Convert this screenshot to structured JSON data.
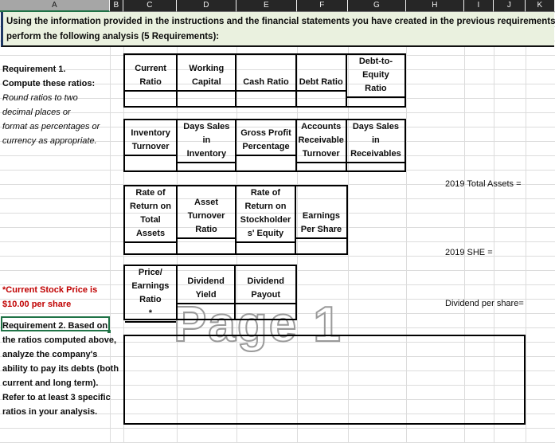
{
  "app": {
    "type": "spreadsheet"
  },
  "columns": [
    {
      "label": "A",
      "selected": true
    },
    {
      "label": "B",
      "selected": false
    },
    {
      "label": "C",
      "selected": false
    },
    {
      "label": "D",
      "selected": false
    },
    {
      "label": "E",
      "selected": false
    },
    {
      "label": "F",
      "selected": false
    },
    {
      "label": "G",
      "selected": false
    },
    {
      "label": "H",
      "selected": false
    },
    {
      "label": "I",
      "selected": false
    },
    {
      "label": "J",
      "selected": false
    },
    {
      "label": "K",
      "selected": false
    }
  ],
  "banner": {
    "line1": "Using the information provided in the instructions and the financial statements you have created in the previous requirements,",
    "line2": "perform the following analysis (5 Requirements):",
    "background_color": "#eaf1df"
  },
  "requirement1": {
    "title_line1": "Requirement 1.",
    "title_line2": "Compute these ratios:",
    "note_line1": "Round ratios to two",
    "note_line2": "decimal places or",
    "note_line3": "format as percentages or",
    "note_line4": "currency as appropriate."
  },
  "stock_note": {
    "line1": "*Current Stock Price is",
    "line2": "$10.00 per share",
    "color": "#c00000"
  },
  "requirement2": {
    "line1": "Requirement 2. Based on",
    "line2": "the ratios computed above,",
    "line3": "analyze the company's",
    "line4": "ability to pay its debts (both",
    "line5": "current and long term).",
    "line6": "Refer to at least 3 specific",
    "line7": "ratios in your analysis."
  },
  "right_labels": [
    {
      "text": "2019 Total Assets ="
    },
    {
      "text": "2019 SHE ="
    },
    {
      "text": "Dividend per share="
    }
  ],
  "ratio_tables": [
    {
      "name": "liquidity-solvency-ratios",
      "headers": [
        [
          "Current",
          "Ratio"
        ],
        [
          "Working",
          "Capital"
        ],
        [
          "Cash Ratio"
        ],
        [
          "Debt Ratio"
        ],
        [
          "Debt-to-",
          "Equity",
          "Ratio"
        ]
      ]
    },
    {
      "name": "efficiency-ratios",
      "headers": [
        [
          "Inventory",
          "Turnover"
        ],
        [
          "Days Sales in",
          "Inventory"
        ],
        [
          "Gross Profit",
          "Percentage"
        ],
        [
          "Accounts",
          "Receivable",
          "Turnover"
        ],
        [
          "Days Sales",
          "in",
          "Receivables"
        ]
      ]
    },
    {
      "name": "profitability-ratios",
      "headers": [
        [
          "Rate of",
          "Return on",
          "Total",
          "Assets"
        ],
        [
          "Asset",
          "Turnover",
          "Ratio"
        ],
        [
          "Rate of",
          "Return on",
          "Stockholder",
          "s' Equity"
        ],
        [
          "Earnings",
          "Per Share"
        ]
      ]
    },
    {
      "name": "market-ratios",
      "headers": [
        [
          "Price/",
          "Earnings",
          "Ratio*"
        ],
        [
          "Dividend",
          "Yield"
        ],
        [
          "Dividend",
          "Payout"
        ]
      ]
    }
  ],
  "watermark": {
    "text": "Page 1",
    "color": "#9a9a9a"
  }
}
